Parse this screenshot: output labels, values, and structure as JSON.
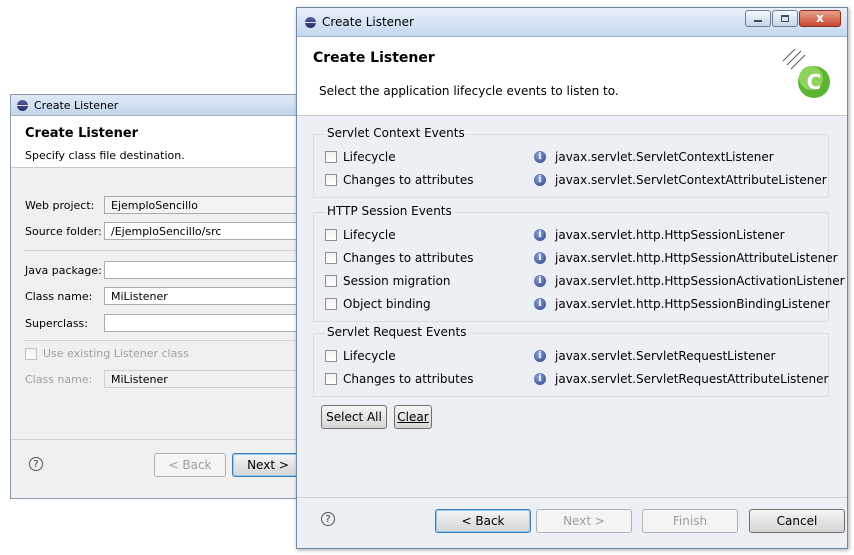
{
  "back_dialog": {
    "title": "Create Listener",
    "header_title": "Create Listener",
    "header_subtitle": "Specify class file destination.",
    "fields": {
      "web_project_label": "Web project:",
      "web_project_value": "EjemploSencillo",
      "source_folder_label": "Source folder:",
      "source_folder_value": "/EjemploSencillo/src",
      "java_package_label": "Java package:",
      "java_package_value": "",
      "class_name_label": "Class name:",
      "class_name_value": "MiListener",
      "superclass_label": "Superclass:",
      "superclass_value": "",
      "use_existing_label": "Use existing Listener class",
      "class_name2_label": "Class name:",
      "class_name2_value": "MiListener"
    },
    "help": "?",
    "back_label": "< Back",
    "next_label": "Next >"
  },
  "main_dialog": {
    "title": "Create Listener",
    "header_title": "Create Listener",
    "header_subtitle": "Select the application lifecycle events to listen to.",
    "groups": [
      {
        "title": "Servlet Context Events",
        "items": [
          {
            "label": "Lifecycle",
            "checked": false,
            "class": "javax.servlet.ServletContextListener"
          },
          {
            "label": "Changes to attributes",
            "checked": false,
            "class": "javax.servlet.ServletContextAttributeListener"
          }
        ]
      },
      {
        "title": "HTTP Session Events",
        "items": [
          {
            "label": "Lifecycle",
            "checked": false,
            "class": "javax.servlet.http.HttpSessionListener"
          },
          {
            "label": "Changes to attributes",
            "checked": false,
            "class": "javax.servlet.http.HttpSessionAttributeListener"
          },
          {
            "label": "Session migration",
            "checked": false,
            "class": "javax.servlet.http.HttpSessionActivationListener"
          },
          {
            "label": "Object binding",
            "checked": false,
            "class": "javax.servlet.http.HttpSessionBindingListener"
          }
        ]
      },
      {
        "title": "Servlet Request Events",
        "items": [
          {
            "label": "Lifecycle",
            "checked": false,
            "class": "javax.servlet.ServletRequestListener"
          },
          {
            "label": "Changes to attributes",
            "checked": false,
            "class": "javax.servlet.ServletRequestAttributeListener"
          }
        ]
      }
    ],
    "select_all_label": "Select All",
    "clear_label": "Clear",
    "help": "?",
    "back_label": "< Back",
    "next_label": "Next >",
    "finish_label": "Finish",
    "cancel_label": "Cancel",
    "close_glyph": "x"
  },
  "colors": {
    "titlebar": "#c5d8ef",
    "dialog_bg": "#eceff3",
    "info_icon": "#2b3f86",
    "logo_green": "#5bb531"
  }
}
